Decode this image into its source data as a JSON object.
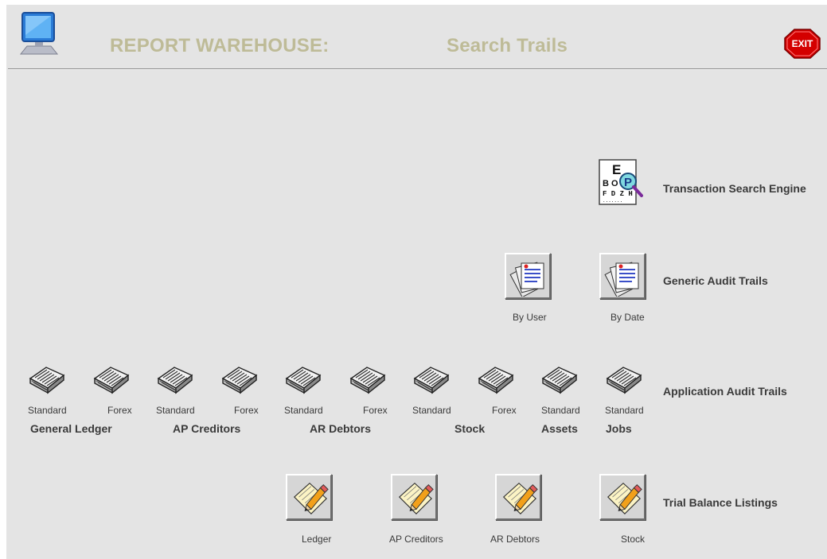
{
  "header": {
    "title": "REPORT WAREHOUSE:",
    "subtitle": "Search Trails",
    "exit_label": "EXIT"
  },
  "colors": {
    "background": "#e4e4e4",
    "header_text": "#bebb97",
    "exit_red": "#d40000",
    "label_text": "#3a3a3a"
  },
  "rows": {
    "transaction_search_engine": "Transaction Search Engine",
    "generic_audit_trails": "Generic Audit Trails",
    "application_audit_trails": "Application Audit Trails",
    "trial_balance_listings": "Trial Balance Listings"
  },
  "generic": {
    "by_user": "By User",
    "by_date": "By Date"
  },
  "application": {
    "items": [
      "Standard",
      "Forex",
      "Standard",
      "Forex",
      "Standard",
      "Forex",
      "Standard",
      "Forex",
      "Standard",
      "Standard"
    ],
    "groups": [
      "General Ledger",
      "AP Creditors",
      "AR Debtors",
      "Stock",
      "Assets",
      "Jobs"
    ]
  },
  "trial_balance": {
    "items": [
      "Ledger",
      "AP Creditors",
      "AR Debtors",
      "Stock"
    ]
  },
  "icons": {
    "app_icon": "computer-monitor-icon",
    "exit_icon": "stop-sign-exit-icon",
    "search_engine_icon": "eye-chart-magnifier-icon",
    "generic_icon": "audit-pages-icon",
    "application_icon": "newspaper-icon",
    "trial_balance_icon": "pencil-paper-icon"
  }
}
